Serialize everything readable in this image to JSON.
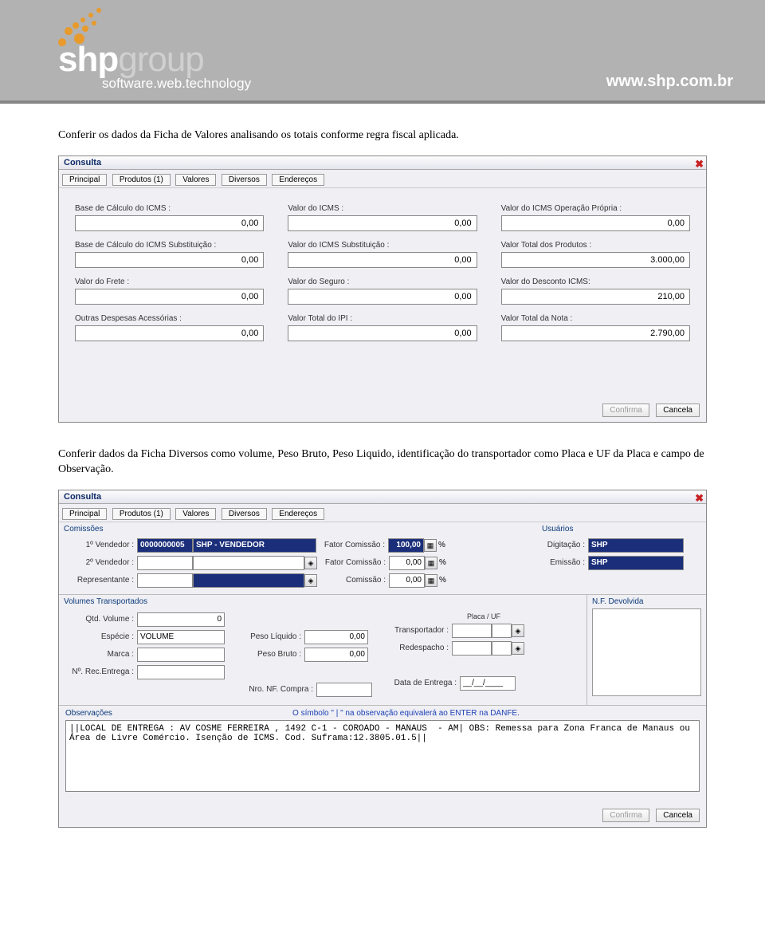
{
  "banner": {
    "logo_main": "shp",
    "logo_suffix": "group",
    "logo_subtitle": "software.web.technology",
    "url": "www.shp.com.br"
  },
  "instruction1": "Conferir os dados da Ficha de Valores analisando os totais conforme regra fiscal aplicada.",
  "instruction2": "Conferir dados da Ficha Diversos como volume, Peso Bruto, Peso Liquido, identificação do transportador como Placa e UF da Placa e campo de Observação.",
  "dialog1": {
    "title": "Consulta",
    "tabs": [
      "Principal",
      "Produtos (1)",
      "Valores",
      "Diversos",
      "Endereços"
    ],
    "fields": [
      {
        "label": "Base de Cálculo do ICMS :",
        "value": "0,00"
      },
      {
        "label": "Valor do ICMS :",
        "value": "0,00"
      },
      {
        "label": "Valor do ICMS Operação Própria :",
        "value": "0,00"
      },
      {
        "label": "Base de Cálculo do ICMS Substituição :",
        "value": "0,00"
      },
      {
        "label": "Valor do ICMS Substituição :",
        "value": "0,00"
      },
      {
        "label": "Valor Total dos Produtos :",
        "value": "3.000,00"
      },
      {
        "label": "Valor do Frete  :",
        "value": "0,00"
      },
      {
        "label": "Valor do Seguro :",
        "value": "0,00"
      },
      {
        "label": "Valor do Desconto ICMS:",
        "value": "210,00"
      },
      {
        "label": "Outras Despesas Acessórias :",
        "value": "0,00"
      },
      {
        "label": "Valor Total do IPI :",
        "value": "0,00"
      },
      {
        "label": "Valor Total da Nota :",
        "value": "2.790,00"
      }
    ],
    "confirm": "Confirma",
    "cancel": "Cancela"
  },
  "dialog2": {
    "title": "Consulta",
    "tabs": [
      "Principal",
      "Produtos (1)",
      "Valores",
      "Diversos",
      "Endereços"
    ],
    "comissoes": {
      "header": "Comissões",
      "vendedor1_label": "1º Vendedor :",
      "vendedor1_code": "0000000005",
      "vendedor1_name": "SHP - VENDEDOR",
      "fator1_label": "Fator Comissão :",
      "fator1_value": "100,00",
      "vendedor2_label": "2º Vendedor :",
      "fator2_label": "Fator Comissão :",
      "fator2_value": "0,00",
      "representante_label": "Representante :",
      "comissao_label": "Comissão :",
      "comissao_value": "0,00"
    },
    "usuarios": {
      "header": "Usuários",
      "digitacao_label": "Digitação :",
      "digitacao_value": "SHP",
      "emissao_label": "Emissão :",
      "emissao_value": "SHP"
    },
    "volumes": {
      "header": "Volumes Transportados",
      "qtd_label": "Qtd. Volume :",
      "qtd_value": "0",
      "especie_label": "Espécie :",
      "especie_value": "VOLUME",
      "marca_label": "Marca :",
      "nrec_label": "Nº. Rec.Entrega :",
      "peso_liquido_label": "Peso Líquido :",
      "peso_liquido_value": "0,00",
      "peso_bruto_label": "Peso Bruto :",
      "peso_bruto_value": "0,00",
      "nro_nf_label": "Nro. NF. Compra :",
      "placa_header": "Placa   / UF",
      "transportador_label": "Transportador :",
      "redespacho_label": "Redespacho :",
      "data_entrega_label": "Data de Entrega :",
      "data_entrega_value": "__/__/____"
    },
    "nf_devolvida": "N.F. Devolvida",
    "obs": {
      "header": "Observações",
      "hint": "O símbolo \" | \" na observação equivalerá ao ENTER na DANFE.",
      "text": "||LOCAL DE ENTREGA : AV COSME FERREIRA , 1492 C-1 - COROADO - MANAUS  - AM| OBS: Remessa para Zona Franca de Manaus ou Área de Livre Comércio. Isenção de ICMS. Cod. Suframa:12.3805.01.5||"
    },
    "confirm": "Confirma",
    "cancel": "Cancela"
  }
}
